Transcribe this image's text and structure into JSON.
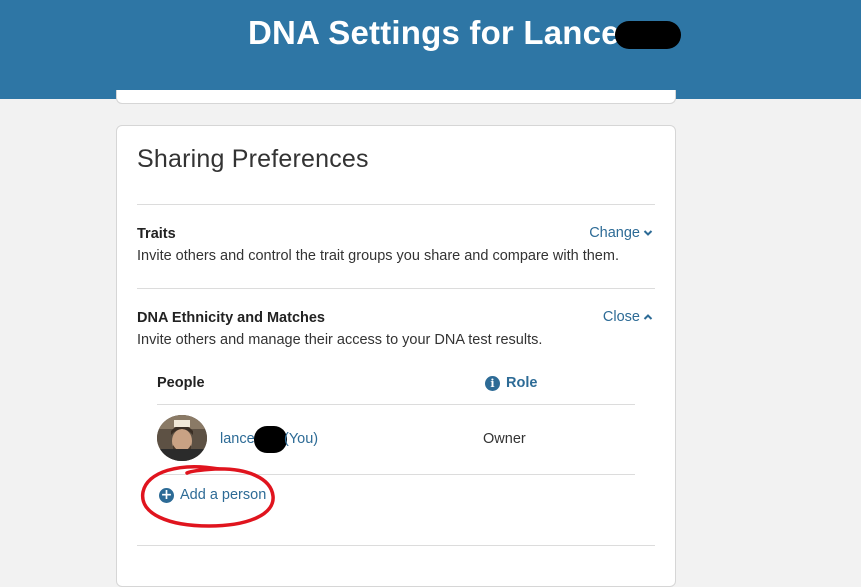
{
  "header": {
    "title": "DNA Settings for Lance",
    "background": "#2e76a5"
  },
  "card": {
    "title": "Sharing Preferences",
    "sections": [
      {
        "title": "Traits",
        "description": "Invite others and control the trait groups you share and compare with them.",
        "toggle_label": "Change",
        "toggle_icon": "chevron-down-icon"
      },
      {
        "title": "DNA Ethnicity and Matches",
        "description": "Invite others and manage their access to your DNA test results.",
        "toggle_label": "Close",
        "toggle_icon": "chevron-up-icon"
      }
    ],
    "table": {
      "headers": [
        "People",
        "Role"
      ],
      "rows": [
        {
          "name": "lance",
          "you_label": "(You)",
          "role": "Owner"
        }
      ]
    },
    "add_person_label": "Add a person"
  },
  "colors": {
    "link": "#2d6b96",
    "annotation": "#e0141e"
  }
}
